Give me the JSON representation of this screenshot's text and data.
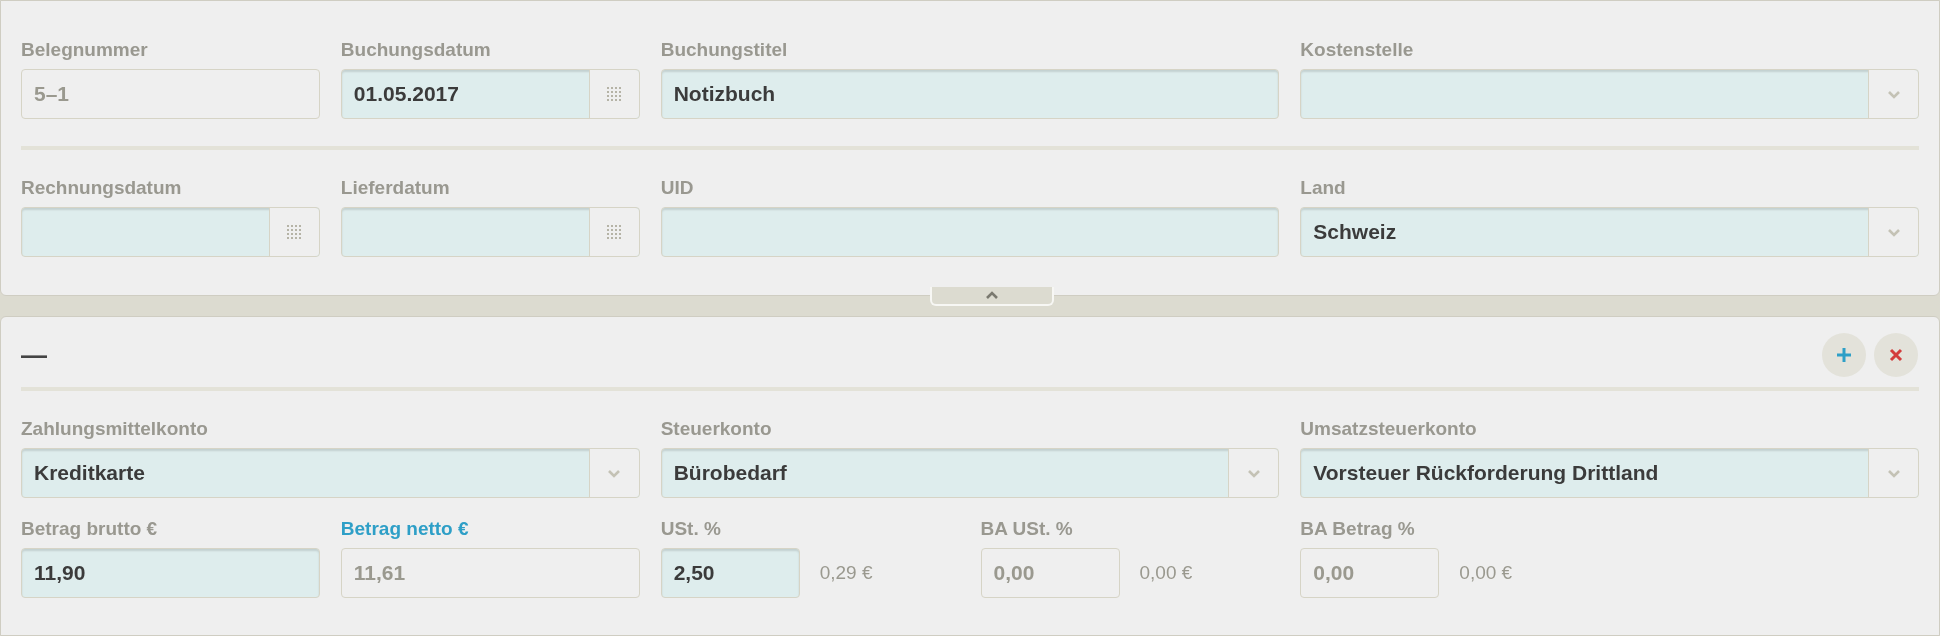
{
  "header": {
    "rows": [
      [
        {
          "kind": "text",
          "label": "Belegnummer",
          "value": "5–1",
          "disabled": true
        },
        {
          "kind": "date",
          "label": "Buchungsdatum",
          "value": "01.05.2017",
          "disabled": false
        },
        {
          "kind": "text",
          "label": "Buchungstitel",
          "value": "Notizbuch",
          "disabled": false
        },
        {
          "kind": "select",
          "label": "Kostenstelle",
          "disabled": false
        }
      ],
      [
        {
          "kind": "date",
          "label": "Rechnungsdatum",
          "disabled": false
        },
        {
          "kind": "date",
          "label": "Lieferdatum",
          "disabled": false
        },
        {
          "kind": "text",
          "label": "UID",
          "disabled": false
        },
        {
          "kind": "select",
          "label": "Land",
          "value": "Schweiz",
          "disabled": false
        }
      ]
    ]
  },
  "collapse_handle": {
    "expanded": true
  },
  "position": {
    "collapse_symbol": "—",
    "accounts": [
      {
        "kind": "select",
        "label": "Zahlungsmittelkonto",
        "value": "Kreditkarte",
        "disabled": false
      },
      {
        "kind": "select",
        "label": "Steuerkonto",
        "value": "Bürobedarf",
        "disabled": false
      },
      {
        "kind": "select",
        "label": "Umsatzsteuerkonto",
        "value": "Vorsteuer Rückforderung Drittland",
        "disabled": false
      }
    ],
    "amounts": [
      {
        "kind": "text",
        "label": "Betrag brutto €",
        "value": "11,90",
        "disabled": false,
        "highlighted": false
      },
      {
        "kind": "text",
        "label": "Betrag netto €",
        "value": "11,61",
        "disabled": true,
        "highlighted": true
      },
      {
        "kind": "percent",
        "label": "USt. %",
        "value": "2,50",
        "amount": "0,29 €",
        "disabled": false,
        "highlighted": false
      },
      {
        "kind": "percent",
        "label": "BA USt. %",
        "value": "0,00",
        "amount": "0,00 €",
        "disabled": true,
        "highlighted": false
      },
      {
        "kind": "percent",
        "label": "BA Betrag %",
        "value": "0,00",
        "amount": "0,00 €",
        "disabled": true,
        "highlighted": false
      }
    ]
  }
}
